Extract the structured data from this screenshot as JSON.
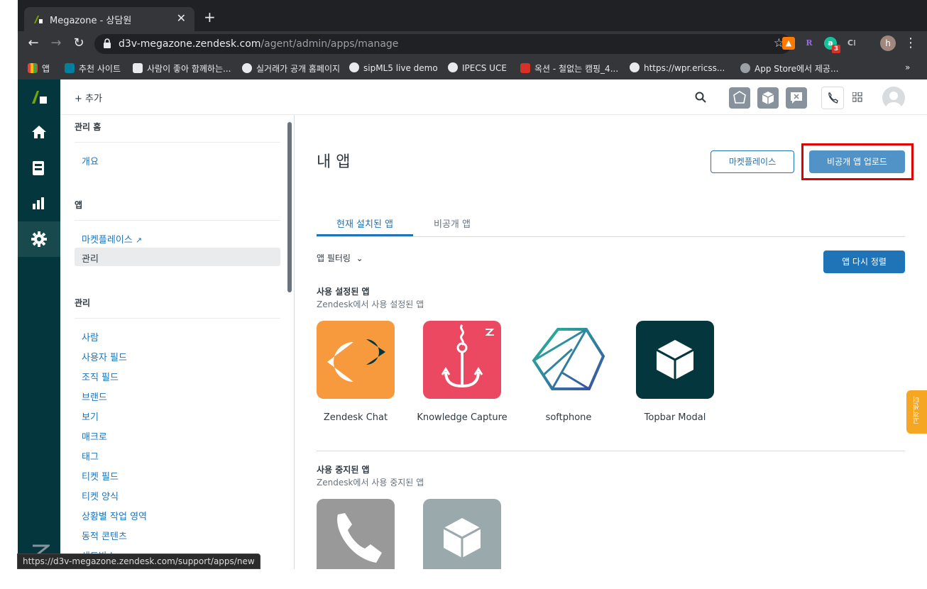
{
  "browser": {
    "tab_title": "Megazone - 상담원",
    "tab_close": "✕",
    "new_tab": "+",
    "url_host": "d3v-megazone.zendesk.com",
    "url_path": "/agent/admin/apps/manage",
    "extensions": [
      "avast-icon",
      "r-extension-icon",
      "grammarly-icon",
      "c-extension-icon"
    ],
    "extension_badge": "3",
    "profile_initial": "h",
    "bookmarks": [
      "앱",
      "추천 사이트",
      "사람이 좋아 함께하는...",
      "실거래가 공개 홈페이지",
      "sipML5 live demo",
      "IPECS UCE",
      "옥션 - 철없는 캠핑_4...",
      "https://wpr.ericss...",
      "App Store에서 제공..."
    ],
    "bookmarks_more": "»",
    "status_url": "https://d3v-megazone.zendesk.com/support/apps/new"
  },
  "topbar": {
    "add_label": "+ 추가"
  },
  "sidebar": {
    "admin_home": "관리 홈",
    "overview": "개요",
    "apps_heading": "앱",
    "marketplace": "마켓플레이스",
    "manage": "관리",
    "manage_heading": "관리",
    "links": [
      "사람",
      "사용자 필드",
      "조직 필드",
      "브랜드",
      "보기",
      "매크로",
      "태그",
      "티켓 필드",
      "티켓 양식",
      "상황별 작업 영역",
      "동적 콘텐츠",
      "샌드박스"
    ]
  },
  "main": {
    "title": "내 앱",
    "marketplace_button": "마켓플레이스",
    "upload_button": "비공개 앱 업로드",
    "tabs": [
      "현재 설치된 앱",
      "비공개 앱"
    ],
    "filter_label": "앱 필터링",
    "sort_button": "앱 다시 정렬",
    "enabled_title": "사용 설정된 앱",
    "enabled_sub": "Zendesk에서 사용 설정된 앱",
    "enabled_apps": [
      "Zendesk Chat",
      "Knowledge Capture",
      "softphone",
      "Topbar Modal"
    ],
    "disabled_title": "사용 중지된 앱",
    "disabled_sub": "Zendesk에서 사용 중지된 앱"
  },
  "help_tab": "고객센터",
  "colors": {
    "nav_bg": "#03363d",
    "accent": "#1f73b7",
    "highlight": "#e00000",
    "chat_orange": "#f79a3e",
    "knowledge_red": "#eb4962",
    "topbar_teal": "#03363d"
  }
}
